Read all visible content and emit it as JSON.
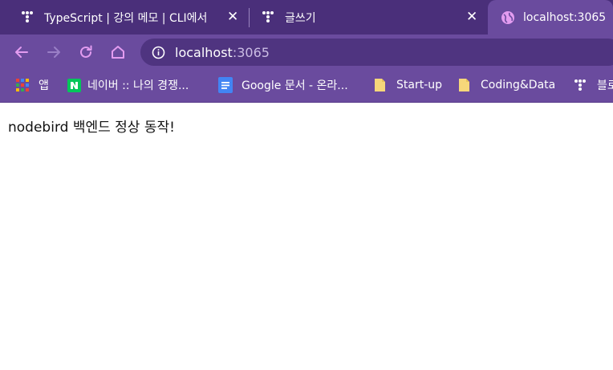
{
  "tabs": [
    {
      "title": "TypeScript | 강의 메모 | CLI에서",
      "favicon": "tistory-icon",
      "close": "✕"
    },
    {
      "title": "글쓰기",
      "favicon": "tistory-icon",
      "close": "✕"
    },
    {
      "title": "localhost:3065",
      "favicon": "globe-icon",
      "active": true
    }
  ],
  "toolbar": {
    "back": "←",
    "forward": "→",
    "reload": "↻",
    "home": "⌂",
    "url_host": "localhost",
    "url_port": ":3065"
  },
  "bookmarks": [
    {
      "label": "앱",
      "icon": "apps-grid-icon"
    },
    {
      "label": "네이버 :: 나의 경쟁...",
      "icon": "naver-icon"
    },
    {
      "label": "Google 문서 - 온라...",
      "icon": "google-docs-icon"
    },
    {
      "label": "Start-up",
      "icon": "folder-icon"
    },
    {
      "label": "Coding&Data",
      "icon": "folder-icon"
    },
    {
      "label": "블로",
      "icon": "tistory-icon"
    }
  ],
  "content": {
    "message": "nodebird 백엔드 정상 동작!"
  },
  "colors": {
    "tabstrip": "#4a2f7a",
    "toolbar": "#6a4b9e",
    "omnibox": "#4f3480",
    "accent_pink": "#e39cf0"
  }
}
